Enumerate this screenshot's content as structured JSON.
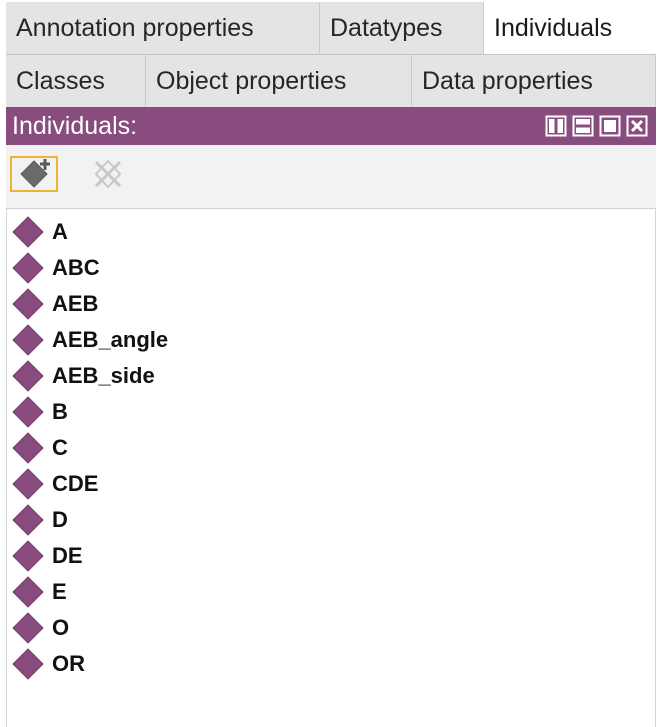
{
  "tabs_row1": [
    {
      "label": "Annotation properties",
      "active": false
    },
    {
      "label": "Datatypes",
      "active": false
    },
    {
      "label": "Individuals",
      "active": true
    }
  ],
  "tabs_row2": [
    {
      "label": "Classes",
      "active": false
    },
    {
      "label": "Object properties",
      "active": false
    },
    {
      "label": "Data properties",
      "active": false
    }
  ],
  "panel": {
    "title": "Individuals:",
    "window_buttons": [
      "split-vertical-icon",
      "split-horizontal-icon",
      "maximize-icon",
      "close-icon"
    ]
  },
  "toolbar": {
    "add_icon": "add-individual-icon",
    "delete_icon": "delete-individual-icon"
  },
  "individuals": [
    {
      "label": "A"
    },
    {
      "label": "ABC"
    },
    {
      "label": "AEB"
    },
    {
      "label": "AEB_angle"
    },
    {
      "label": "AEB_side"
    },
    {
      "label": "B"
    },
    {
      "label": "C"
    },
    {
      "label": "CDE"
    },
    {
      "label": "D"
    },
    {
      "label": "DE"
    },
    {
      "label": "E"
    },
    {
      "label": "O"
    },
    {
      "label": "OR"
    }
  ],
  "colors": {
    "accent": "#884c7e",
    "diamond": "#884c7e",
    "selection_border": "#f0b232"
  }
}
